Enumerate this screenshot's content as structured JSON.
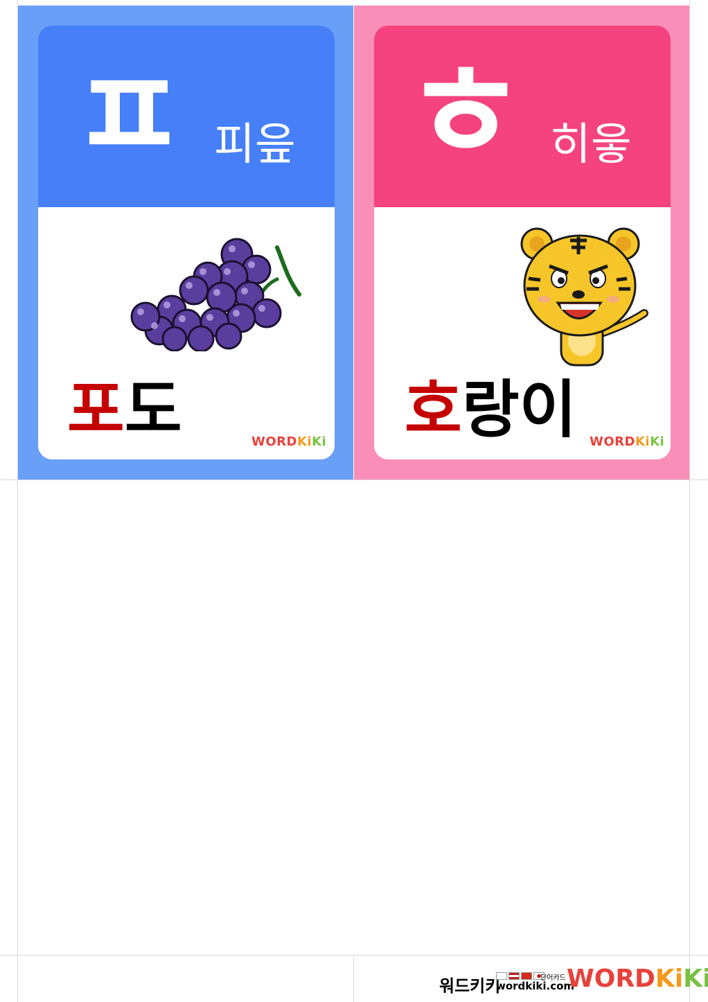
{
  "cards": [
    {
      "letter": "ㅍ",
      "letter_name": "피읖",
      "word_first": "포",
      "word_rest": "도",
      "picture": "grapes-icon",
      "colors": {
        "outer": "#6a9ff8",
        "header": "#467ff8"
      }
    },
    {
      "letter": "ㅎ",
      "letter_name": "히읗",
      "word_first": "호",
      "word_rest": "랑이",
      "picture": "tiger-icon",
      "colors": {
        "outer": "#f98fb9",
        "header": "#f5437f"
      }
    }
  ],
  "card_logo": {
    "w": "WORD",
    "k1": "Ki",
    "k2": "Ki"
  },
  "footer": {
    "brand_korean": "워드키키",
    "flags_label": "단어카드",
    "url": "wordkiki.com",
    "logo": {
      "w": "WORD",
      "k1": "Ki",
      "k2": "Ki"
    }
  },
  "accent_red": "#c40000"
}
